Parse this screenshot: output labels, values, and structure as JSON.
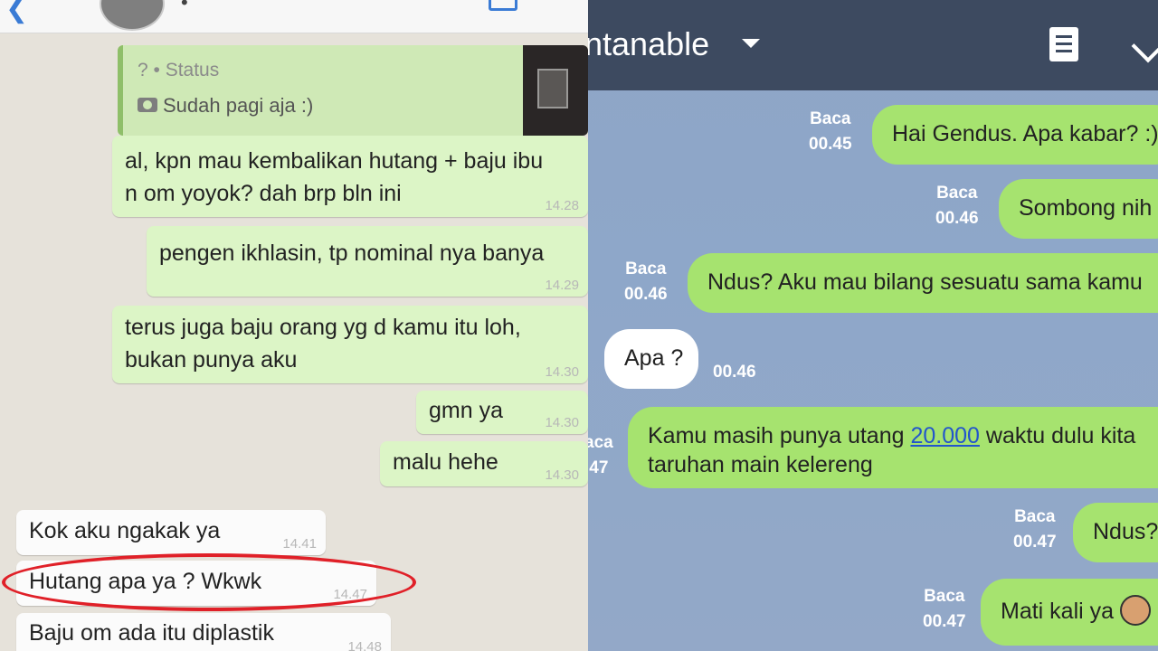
{
  "left_pane": {
    "quoted_status": {
      "label": "? • Status",
      "text": "Sudah pagi aja :)"
    },
    "messages": [
      {
        "text": "al, kpn mau kembalikan hutang + baju ibu\nn om yoyok? dah brp bln ini",
        "time": "14.28",
        "side": "out"
      },
      {
        "text": "pengen ikhlasin, tp nominal nya banya",
        "time": "14.29",
        "side": "out"
      },
      {
        "text": "terus juga baju orang yg d kamu itu loh,\nbukan punya aku",
        "time": "14.30",
        "side": "out"
      },
      {
        "text": "gmn ya",
        "time": "14.30",
        "side": "out"
      },
      {
        "text": "malu hehe",
        "time": "14.30",
        "side": "out"
      },
      {
        "text": "Kok aku ngakak ya",
        "time": "14.41",
        "side": "in"
      },
      {
        "text": "Hutang apa ya ? Wkwk",
        "time": "14.47",
        "side": "in",
        "highlighted": true
      },
      {
        "text": "Baju om ada itu diplastik",
        "time": "14.48",
        "side": "in"
      }
    ]
  },
  "right_pane": {
    "title": "ntanable",
    "messages": [
      {
        "text": "Hai Gendus. Apa kabar? :)",
        "status": "Baca",
        "time": "00.45",
        "side": "out"
      },
      {
        "text": "Sombong nih",
        "status": "Baca",
        "time": "00.46",
        "side": "out"
      },
      {
        "text": "Ndus? Aku mau bilang sesuatu sama kamu",
        "status": "Baca",
        "time": "00.46",
        "side": "out"
      },
      {
        "text": "Apa ?",
        "time": "00.46",
        "side": "in"
      },
      {
        "text_before": "Kamu masih punya utang ",
        "link": "20.000",
        "text_after": " waktu dulu kita",
        "line2": "taruhan main kelereng",
        "status": "aca",
        "time": ".47",
        "side": "out"
      },
      {
        "text": "Ndus?",
        "status": "Baca",
        "time": "00.47",
        "side": "out"
      },
      {
        "text": "Mati kali ya",
        "status": "Baca",
        "time": "00.47",
        "side": "out",
        "sticker": "face-emoji"
      }
    ]
  }
}
